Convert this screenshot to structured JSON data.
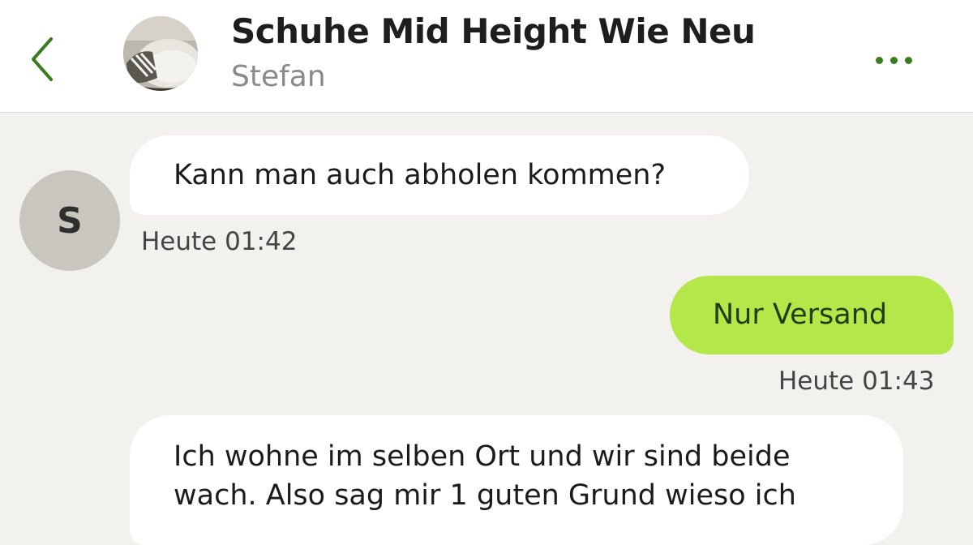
{
  "header": {
    "title": "Schuhe Mid Height Wie Neu",
    "subtitle": "Stefan",
    "back_icon": "chevron-left-icon",
    "more_icon": "more-horizontal-icon",
    "listing_thumbnail": "product-thumbnail",
    "accent_color": "#3a7d1e"
  },
  "chat": {
    "contact_initial": "S",
    "messages": [
      {
        "direction": "incoming",
        "text": "Kann man auch abholen kommen?",
        "time": "Heute 01:42"
      },
      {
        "direction": "outgoing",
        "text": "Nur Versand",
        "time": "Heute 01:43"
      },
      {
        "direction": "incoming",
        "text": "Ich wohne im selben Ort und wir sind beide wach. Also sag mir 1 guten Grund wieso ich",
        "time": ""
      }
    ],
    "incoming_bubble_color": "#ffffff",
    "outgoing_bubble_color": "#b4e84a",
    "background_color": "#f2f1ee"
  }
}
